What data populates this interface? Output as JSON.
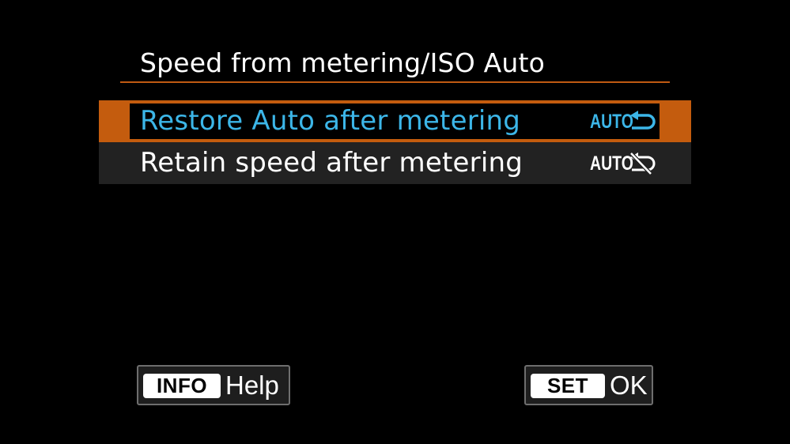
{
  "menu": {
    "title": "Speed from metering/ISO Auto"
  },
  "options": [
    {
      "label": "Restore Auto after metering",
      "icon_text": "AUTO",
      "icon": "return-arrow-icon",
      "selected": true
    },
    {
      "label": "Retain speed after metering",
      "icon_text": "AUTO",
      "icon": "return-arrow-crossed-icon",
      "selected": false
    }
  ],
  "footer": {
    "help_key": "INFO",
    "help_label": "Help",
    "ok_key": "SET",
    "ok_label": "OK"
  },
  "colors": {
    "background": "#000000",
    "accent_orange": "#c45c0e",
    "selected_text": "#3cb6e8",
    "row_background": "#222222"
  }
}
